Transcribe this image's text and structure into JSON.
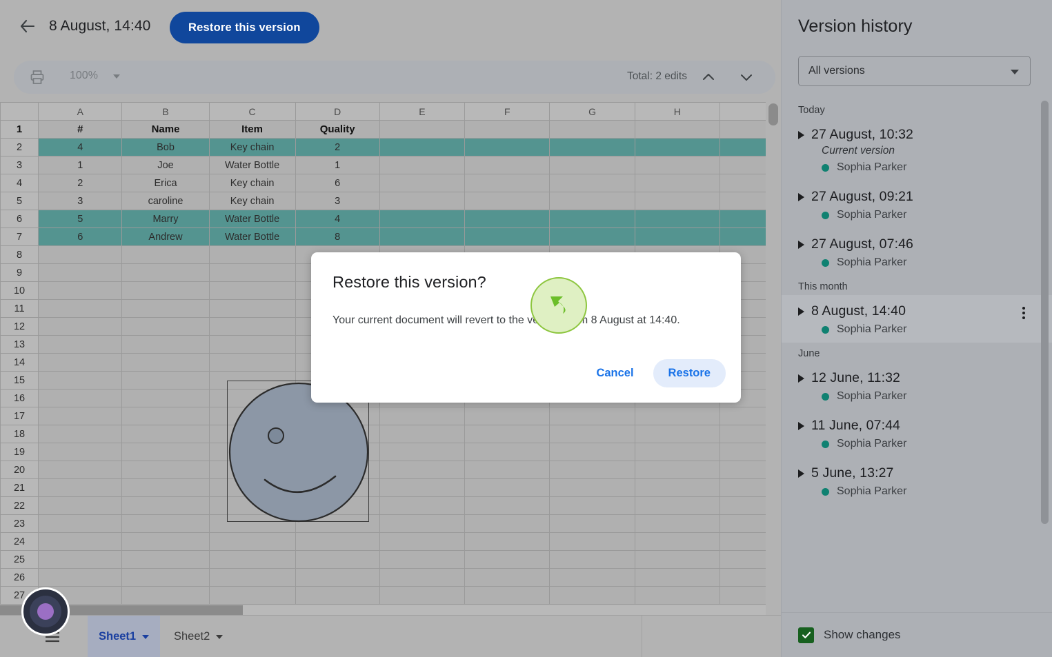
{
  "topbar": {
    "back_icon": "back-arrow-icon",
    "version_title": "8 August, 14:40",
    "restore_button": "Restore this version"
  },
  "toolbar": {
    "print_icon": "print-icon",
    "zoom_level": "100%",
    "zoom_caret_icon": "chevron-down-icon",
    "edits_total": "Total: 2 edits",
    "prev_edit_icon": "chevron-up-icon",
    "next_edit_icon": "chevron-down-icon"
  },
  "sheet": {
    "column_headers": [
      "A",
      "B",
      "C",
      "D",
      "E",
      "F",
      "G",
      "H"
    ],
    "rows": [
      {
        "num": "1",
        "cells": [
          "#",
          "Name",
          "Item",
          "Quality",
          "",
          "",
          "",
          "",
          ""
        ],
        "header": true,
        "changed": false
      },
      {
        "num": "2",
        "cells": [
          "4",
          "Bob",
          "Key chain",
          "2",
          "",
          "",
          "",
          "",
          ""
        ],
        "header": false,
        "changed": true
      },
      {
        "num": "3",
        "cells": [
          "1",
          "Joe",
          "Water Bottle",
          "1",
          "",
          "",
          "",
          "",
          ""
        ],
        "header": false,
        "changed": false
      },
      {
        "num": "4",
        "cells": [
          "2",
          "Erica",
          "Key chain",
          "6",
          "",
          "",
          "",
          "",
          ""
        ],
        "header": false,
        "changed": false
      },
      {
        "num": "5",
        "cells": [
          "3",
          "caroline",
          "Key chain",
          "3",
          "",
          "",
          "",
          "",
          ""
        ],
        "header": false,
        "changed": false
      },
      {
        "num": "6",
        "cells": [
          "5",
          "Marry",
          "Water Bottle",
          "4",
          "",
          "",
          "",
          "",
          ""
        ],
        "header": false,
        "changed": true
      },
      {
        "num": "7",
        "cells": [
          "6",
          "Andrew",
          "Water Bottle",
          "8",
          "",
          "",
          "",
          "",
          ""
        ],
        "header": false,
        "changed": true
      },
      {
        "num": "8",
        "cells": [
          "",
          "",
          "",
          "",
          "",
          "",
          "",
          "",
          ""
        ],
        "header": false,
        "changed": false
      },
      {
        "num": "9",
        "cells": [
          "",
          "",
          "",
          "",
          "",
          "",
          "",
          "",
          ""
        ],
        "header": false,
        "changed": false
      },
      {
        "num": "10",
        "cells": [
          "",
          "",
          "",
          "",
          "",
          "",
          "",
          "",
          ""
        ],
        "header": false,
        "changed": false
      },
      {
        "num": "11",
        "cells": [
          "",
          "",
          "",
          "",
          "",
          "",
          "",
          "",
          ""
        ],
        "header": false,
        "changed": false
      },
      {
        "num": "12",
        "cells": [
          "",
          "",
          "",
          "",
          "",
          "",
          "",
          "",
          ""
        ],
        "header": false,
        "changed": false
      },
      {
        "num": "13",
        "cells": [
          "",
          "",
          "",
          "",
          "",
          "",
          "",
          "",
          ""
        ],
        "header": false,
        "changed": false
      },
      {
        "num": "14",
        "cells": [
          "",
          "",
          "",
          "",
          "",
          "",
          "",
          "",
          ""
        ],
        "header": false,
        "changed": false
      },
      {
        "num": "15",
        "cells": [
          "",
          "",
          "",
          "",
          "",
          "",
          "",
          "",
          ""
        ],
        "header": false,
        "changed": false
      },
      {
        "num": "16",
        "cells": [
          "",
          "",
          "",
          "",
          "",
          "",
          "",
          "",
          ""
        ],
        "header": false,
        "changed": false
      },
      {
        "num": "17",
        "cells": [
          "",
          "",
          "",
          "",
          "",
          "",
          "",
          "",
          ""
        ],
        "header": false,
        "changed": false
      },
      {
        "num": "18",
        "cells": [
          "",
          "",
          "",
          "",
          "",
          "",
          "",
          "",
          ""
        ],
        "header": false,
        "changed": false
      },
      {
        "num": "19",
        "cells": [
          "",
          "",
          "",
          "",
          "",
          "",
          "",
          "",
          ""
        ],
        "header": false,
        "changed": false
      },
      {
        "num": "20",
        "cells": [
          "",
          "",
          "",
          "",
          "",
          "",
          "",
          "",
          ""
        ],
        "header": false,
        "changed": false
      },
      {
        "num": "21",
        "cells": [
          "",
          "",
          "",
          "",
          "",
          "",
          "",
          "",
          ""
        ],
        "header": false,
        "changed": false
      },
      {
        "num": "22",
        "cells": [
          "",
          "",
          "",
          "",
          "",
          "",
          "",
          "",
          ""
        ],
        "header": false,
        "changed": false
      },
      {
        "num": "23",
        "cells": [
          "",
          "",
          "",
          "",
          "",
          "",
          "",
          "",
          ""
        ],
        "header": false,
        "changed": false
      },
      {
        "num": "24",
        "cells": [
          "",
          "",
          "",
          "",
          "",
          "",
          "",
          "",
          ""
        ],
        "header": false,
        "changed": false
      },
      {
        "num": "25",
        "cells": [
          "",
          "",
          "",
          "",
          "",
          "",
          "",
          "",
          ""
        ],
        "header": false,
        "changed": false
      },
      {
        "num": "26",
        "cells": [
          "",
          "",
          "",
          "",
          "",
          "",
          "",
          "",
          ""
        ],
        "header": false,
        "changed": false
      },
      {
        "num": "27",
        "cells": [
          "",
          "",
          "",
          "",
          "",
          "",
          "",
          "",
          ""
        ],
        "header": false,
        "changed": false
      }
    ],
    "embedded_image": "smiley-face-drawing",
    "changed_row_color": "#549490"
  },
  "sheetbar": {
    "all_sheets_icon": "all-sheets-icon",
    "tabs": [
      {
        "label": "Sheet1",
        "active": true
      },
      {
        "label": "Sheet2",
        "active": false
      }
    ]
  },
  "version_history": {
    "title": "Version history",
    "filter_value": "All versions",
    "groups": [
      {
        "label": "Today",
        "items": [
          {
            "date": "27 August, 10:32",
            "note": "Current version",
            "author": "Sophia Parker",
            "selected": false
          },
          {
            "date": "27 August, 09:21",
            "note": "",
            "author": "Sophia Parker",
            "selected": false
          },
          {
            "date": "27 August, 07:46",
            "note": "",
            "author": "Sophia Parker",
            "selected": false
          }
        ]
      },
      {
        "label": "This month",
        "items": [
          {
            "date": "8 August, 14:40",
            "note": "",
            "author": "Sophia Parker",
            "selected": true
          }
        ]
      },
      {
        "label": "June",
        "items": [
          {
            "date": "12 June, 11:32",
            "note": "",
            "author": "Sophia Parker",
            "selected": false
          },
          {
            "date": "11 June, 07:44",
            "note": "",
            "author": "Sophia Parker",
            "selected": false
          },
          {
            "date": "5 June, 13:27",
            "note": "",
            "author": "Sophia Parker",
            "selected": false
          }
        ]
      }
    ],
    "show_changes_label": "Show changes",
    "show_changes_checked": true,
    "author_dot_color": "#0f8171",
    "checkbox_color": "#17601f",
    "more_icon": "more-vertical-icon"
  },
  "modal": {
    "title": "Restore this version?",
    "body": "Your current document will revert to the version from 8 August at 14:40.",
    "cancel_label": "Cancel",
    "restore_label": "Restore",
    "accent_color": "#1a73e8"
  },
  "overlays": {
    "cursor_highlight_icon": "undo-arrow-cursor-icon",
    "recorder_badge_icon": "recording-indicator-icon"
  }
}
